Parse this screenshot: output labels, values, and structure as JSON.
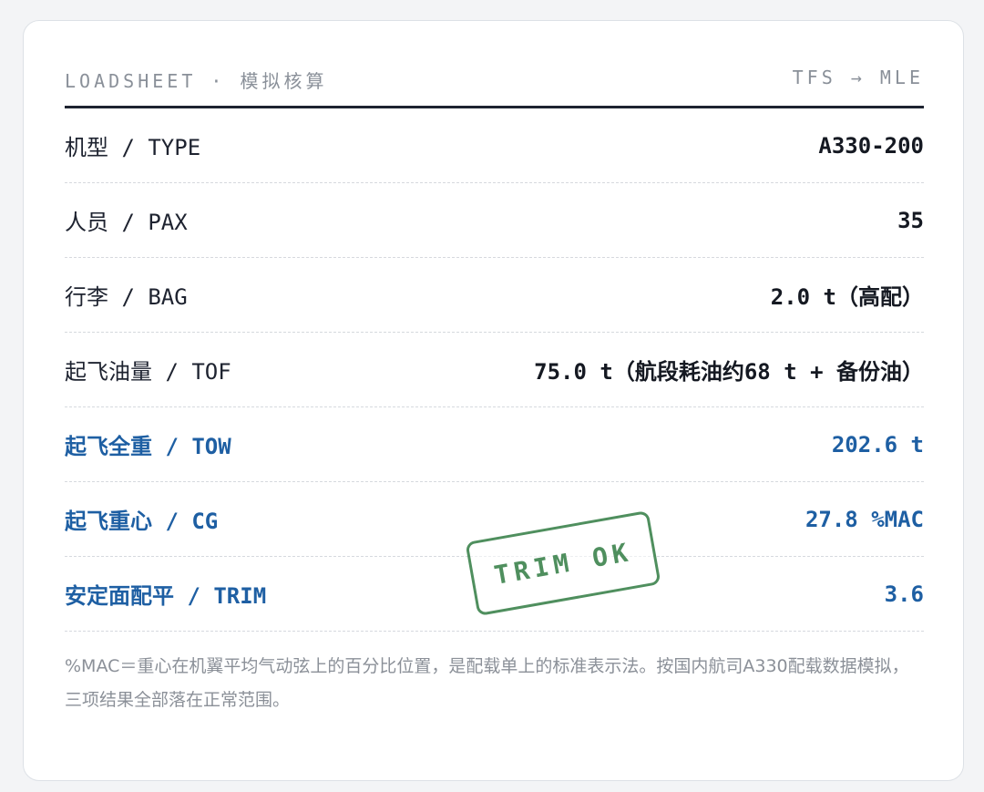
{
  "header": {
    "left": "LOADSHEET · 模拟核算",
    "right": "TFS → MLE"
  },
  "rows": [
    {
      "label": "机型 / TYPE",
      "value": "A330-200"
    },
    {
      "label": "人员 / PAX",
      "value": "35"
    },
    {
      "label": "行李 / BAG",
      "value": "2.0 t（高配）"
    },
    {
      "label": "起飞油量 / TOF",
      "value": "75.0 t（航段耗油约68 t + 备份油）"
    },
    {
      "label": "起飞全重 / TOW",
      "value": "202.6 t"
    },
    {
      "label": "起飞重心 / CG",
      "value": "27.8 %MAC"
    },
    {
      "label": "安定面配平 / TRIM",
      "value": "3.6"
    }
  ],
  "stamp": "TRIM OK",
  "note": "%MAC＝重心在机翼平均气动弦上的百分比位置，是配载单上的标准表示法。按国内航司A330配载数据模拟，三项结果全部落在正常范围。",
  "colors": {
    "highlight": "#1e5fa3",
    "stamp": "#4f8f5e"
  }
}
